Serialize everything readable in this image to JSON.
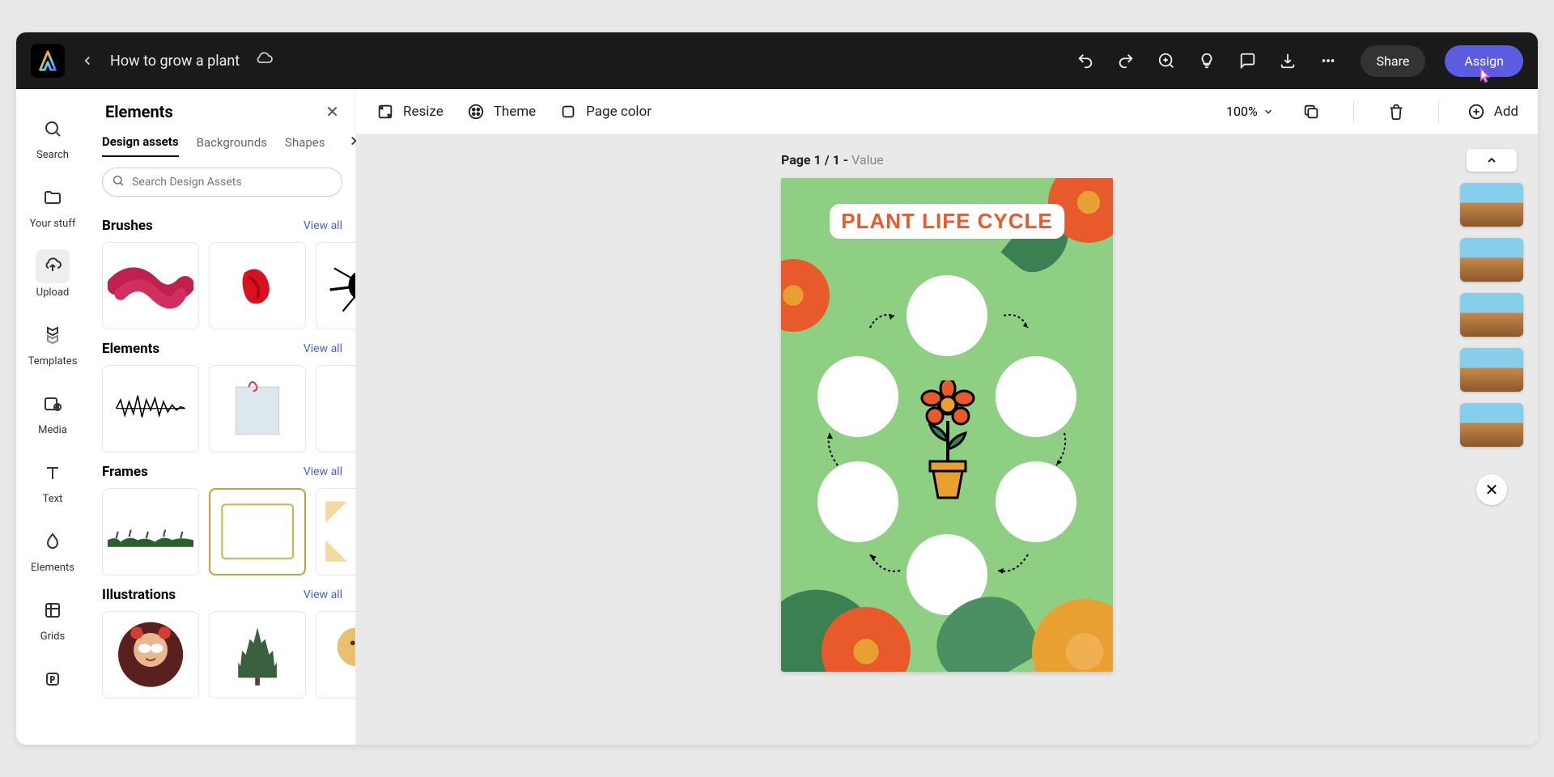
{
  "header": {
    "doc_title": "How to grow a plant",
    "share_label": "Share",
    "assign_label": "Assign"
  },
  "left_rail": {
    "search": "Search",
    "your_stuff": "Your stuff",
    "upload": "Upload",
    "templates": "Templates",
    "media": "Media",
    "text": "Text",
    "elements": "Elements",
    "grids": "Grids"
  },
  "elements_panel": {
    "title": "Elements",
    "tabs": {
      "design_assets": "Design assets",
      "backgrounds": "Backgrounds",
      "shapes": "Shapes"
    },
    "search_placeholder": "Search Design Assets",
    "view_all": "View all",
    "sections": {
      "brushes": "Brushes",
      "elements": "Elements",
      "frames": "Frames",
      "illustrations": "Illustrations"
    }
  },
  "toolbar": {
    "resize": "Resize",
    "theme": "Theme",
    "page_color": "Page color",
    "zoom": "100%",
    "add": "Add"
  },
  "canvas": {
    "page_label_prefix": "Page 1 / 1 - ",
    "page_label_value": "Value",
    "poster_title": "PLANT LIFE CYCLE"
  }
}
